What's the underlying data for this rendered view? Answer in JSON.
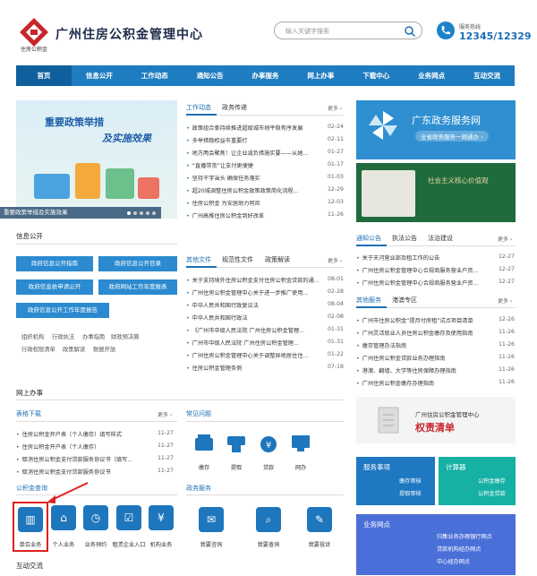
{
  "header": {
    "logo_sub": "住房公积金",
    "title": "广州住房公积金管理中心",
    "search_placeholder": "输入关键字搜索",
    "hotline_label": "服务热线",
    "hotline_number": "12345/12329"
  },
  "nav": [
    "首页",
    "信息公开",
    "工作动态",
    "通知公告",
    "办事服务",
    "网上办事",
    "下载中心",
    "业务网点",
    "互动交流"
  ],
  "banner": {
    "title1": "重要政策举措",
    "title2": "及实施效果",
    "caption": "重要政策举措及实施效果"
  },
  "news": {
    "tabs": [
      "工作动态",
      "政务传递"
    ],
    "more": "更多 ›",
    "items": [
      {
        "t": "政策组合拳持续推进超级城市地平稳有序发展",
        "d": "02-24"
      },
      {
        "t": "多举措稳权益市重要打",
        "d": "02-11"
      },
      {
        "t": "地方两会聚焦！让企业减负措施实要——从她...",
        "d": "01-27"
      },
      {
        "t": "“直播带货”让支付更便捷",
        "d": "01-17"
      },
      {
        "t": "坚持干字当头 确保任务落实",
        "d": "01-03"
      },
      {
        "t": "超20城调整住房公积金政策政策简化流程...",
        "d": "12-29"
      },
      {
        "t": "住房公积金 为安居助力阿尼",
        "d": "12-03"
      },
      {
        "t": "广州高推住房公积金到好改革",
        "d": "11-26"
      }
    ]
  },
  "right_banner1": {
    "title": "广东政务服务网",
    "sub": "全省政务服务一网通办 ›"
  },
  "right_banner2": {
    "title": "社会主义核心价值观"
  },
  "info_public": {
    "title": "信息公开",
    "buttons": [
      "政府信息公开指南",
      "政府信息公开目录",
      "政府信息依申请公开",
      "政府网站工作年度报表",
      "政府信息公开工作年度报告"
    ],
    "links": [
      "组织机构",
      "行政执法",
      "办事指南",
      "财政预决算",
      "行政权限清单",
      "政策解读",
      "数据开放"
    ]
  },
  "files": {
    "tabs": [
      "其他文件",
      "规范性文件",
      "政策解读"
    ],
    "more": "更多 ›",
    "items": [
      {
        "t": "关于支持境外住房公积金支付住房公积金贷款的通...",
        "d": "08-01"
      },
      {
        "t": "广州住房公积金管理中心关于进一步推广使用...",
        "d": "02-28"
      },
      {
        "t": "中华人民共和国行政复议法",
        "d": "08-04"
      },
      {
        "t": "中华人民共和国行政法",
        "d": "02-08"
      },
      {
        "t": "《广州市中级人民法院 广州住房公积金管理...",
        "d": "01-31"
      },
      {
        "t": "广州市中级人民法院 广州住房公积金管理...",
        "d": "01-31"
      },
      {
        "t": "广州住房公积金管理中心关于调整异地居住住...",
        "d": "01-22"
      },
      {
        "t": "住房公积金管理条例",
        "d": "07-18"
      }
    ]
  },
  "notices": {
    "tabs": [
      "通知公告",
      "执法公告",
      "法治建设"
    ],
    "more": "更多 ›",
    "items": [
      {
        "t": "关于天河营业部及租工作的公告",
        "d": "12-27"
      },
      {
        "t": "广州住房公积金管理中心合规商服务营业户资...",
        "d": "12-27"
      },
      {
        "t": "广州住房公积金管理中心合规商服务营业户资...",
        "d": "12-27"
      }
    ]
  },
  "others": {
    "tabs": [
      "其他服务",
      "港澳专区"
    ],
    "more": "更多 ›",
    "items": [
      {
        "t": "广州市住房公积金“提月付房租”试点项目清单",
        "d": "12-26"
      },
      {
        "t": "广州灵活就业人员住房公积金缴存及使用指南",
        "d": "11-26"
      },
      {
        "t": "缴存管理办法指南",
        "d": "11-26"
      },
      {
        "t": "广州住房公积金贷款业务办理指南",
        "d": "11-26"
      },
      {
        "t": "港澳、翻墙、大学等住房保障办理指南",
        "d": "11-26"
      },
      {
        "t": "广州住房公积金缴存办理指南",
        "d": "11-26"
      }
    ]
  },
  "online": {
    "title": "网上办事"
  },
  "forms": {
    "title": "表格下载",
    "more": "更多 ›",
    "items": [
      {
        "t": "住房公积金开户表（个人缴存）填写样式",
        "d": "11-27"
      },
      {
        "t": "住房公积金开户表（个人缴存）",
        "d": "11-27"
      },
      {
        "t": "取消住房公积金支付贷款服务协议书（填写...",
        "d": "11-27"
      },
      {
        "t": "取消住房公积金支付贷款服务协议书",
        "d": "11-27"
      }
    ]
  },
  "faq": {
    "title": "常见问题",
    "items": [
      "缴存",
      "提取",
      "贷款",
      "网办"
    ]
  },
  "query": {
    "title": "公积金查询",
    "items": [
      "单位业务",
      "个人业务",
      "业务预约",
      "租赁企业入口",
      "机构业务"
    ]
  },
  "service": {
    "title": "政务服务",
    "items": [
      "我要咨询",
      "我要查询",
      "我要投诉"
    ]
  },
  "rights": {
    "line1": "广州住房公积金管理中心",
    "line2": "权责清单"
  },
  "biz": {
    "title": "服务事项",
    "items": [
      "缴存审核",
      "提取审核"
    ]
  },
  "calc": {
    "title": "计算器",
    "items": [
      "公积金缴存",
      "公积金贷款"
    ]
  },
  "outlets": {
    "title": "业务网点",
    "items": [
      "归集业务办理银行网点",
      "贷款机构经办网点",
      "中心经办网点"
    ]
  },
  "interact": {
    "title": "互动交流"
  }
}
